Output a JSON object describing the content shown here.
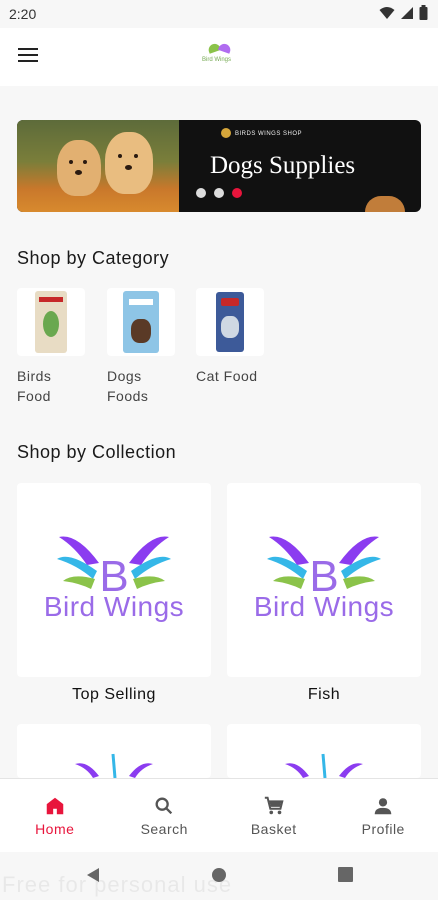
{
  "status_bar": {
    "time": "2:20",
    "icons": [
      "wifi-icon",
      "signal-icon",
      "battery-icon"
    ]
  },
  "app_bar": {
    "menu_icon": "menu-icon",
    "logo_text": "Bird Wings"
  },
  "banner": {
    "shop_name": "BIRDS WINGS SHOP",
    "title": "Dogs Supplies",
    "slides": 3,
    "active_slide": 3,
    "active_color": "#e8153c"
  },
  "categories": {
    "title": "Shop by Category",
    "items": [
      {
        "label": "Birds Food"
      },
      {
        "label": "Dogs Foods"
      },
      {
        "label": "Cat Food"
      }
    ]
  },
  "collections": {
    "title": "Shop by Collection",
    "logo_text": "Bird Wings",
    "items": [
      {
        "label": "Top Selling"
      },
      {
        "label": "Fish"
      }
    ]
  },
  "bottom_nav": {
    "accent": "#e8153c",
    "items": [
      {
        "label": "Home",
        "icon": "home-icon",
        "active": true
      },
      {
        "label": "Search",
        "icon": "search-icon",
        "active": false
      },
      {
        "label": "Basket",
        "icon": "cart-icon",
        "active": false
      },
      {
        "label": "Profile",
        "icon": "profile-icon",
        "active": false
      }
    ]
  },
  "watermark": "Free for personal use"
}
